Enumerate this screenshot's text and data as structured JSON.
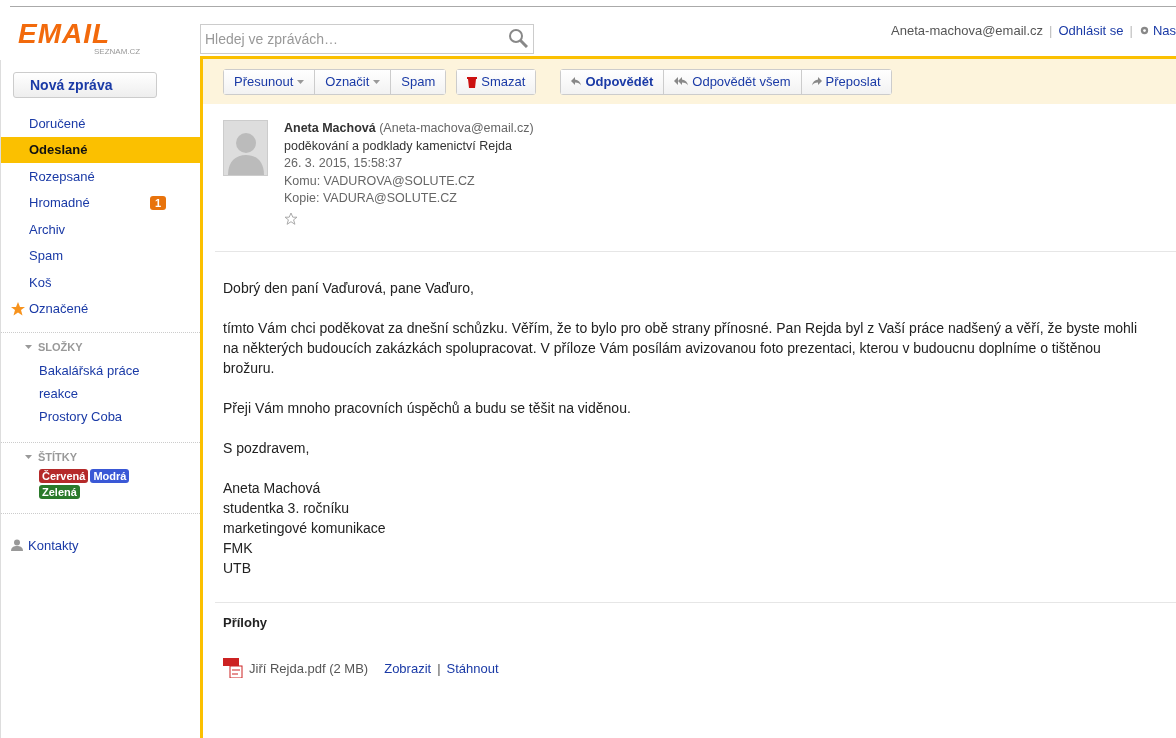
{
  "logo": {
    "title": "EMAIL",
    "subtitle": "SEZNAM.CZ"
  },
  "search": {
    "placeholder": "Hledej ve zprávách…"
  },
  "account": {
    "email": "Aneta-machova@email.cz",
    "separator_1": "|",
    "logout": "Odhlásit se",
    "separator_2": "|",
    "settings": "Nas"
  },
  "new_message": "Nová zpráva",
  "folders": [
    {
      "label": "Doručené",
      "selected": false
    },
    {
      "label": "Odeslané",
      "selected": true
    },
    {
      "label": "Rozepsané",
      "selected": false
    },
    {
      "label": "Hromadné",
      "selected": false,
      "badge": "1"
    },
    {
      "label": "Archiv",
      "selected": false
    },
    {
      "label": "Spam",
      "selected": false
    },
    {
      "label": "Koš",
      "selected": false
    },
    {
      "label": "Označené",
      "selected": false,
      "kind": "starred"
    }
  ],
  "custom_folders": {
    "title": "SLOŽKY",
    "items": [
      "Bakalářská práce",
      "reakce",
      "Prostory Coba"
    ]
  },
  "labels": {
    "title": "ŠTÍTKY",
    "items": [
      {
        "label": "Červená",
        "color": "#b52a2a"
      },
      {
        "label": "Modrá",
        "color": "#3a58d6"
      },
      {
        "label": "Zelená",
        "color": "#2b7a2b"
      }
    ]
  },
  "contacts": "Kontakty",
  "toolbar": [
    {
      "kind": "menu",
      "label": "Přesunout"
    },
    {
      "kind": "menu",
      "label": "Označit"
    },
    {
      "kind": "plain",
      "label": "Spam"
    },
    {
      "kind": "delete",
      "label": "Smazat"
    },
    {
      "kind": "reply",
      "label": "Odpovědět"
    },
    {
      "kind": "reply_all",
      "label": "Odpovědět všem"
    },
    {
      "kind": "forward",
      "label": "Přeposlat"
    }
  ],
  "message": {
    "sender": "Aneta Machová",
    "sender_email": "(Aneta-machova@email.cz)",
    "subject": "poděkování a podklady kamenictví Rejda",
    "date": "26. 3. 2015, 15:58:37",
    "to": "Komu: VADUROVA@SOLUTE.CZ",
    "cc": "Kopie: VADURA@SOLUTE.CZ",
    "starred": false,
    "body": [
      [
        "Dobrý den paní Vaďurová, pane Vaďuro,"
      ],
      [
        " tímto Vám chci poděkovat za dnešní schůzku. Věřím, že to bylo pro obě strany přínosné. Pan Rejda byl z Vaší práce nadšený a věří, že byste mohli na některých budoucích zakázkách spolupracovat. V příloze Vám posílám avizovanou foto prezentaci, kterou v budoucnu doplníme o tištěnou brožuru."
      ],
      [
        "Přeji Vám mnoho pracovních úspěchů a budu se těšit na viděnou."
      ],
      [
        "S pozdravem,"
      ],
      [
        "Aneta Machová",
        "studentka 3. ročníku",
        "marketingové komunikace",
        "FMK",
        "UTB"
      ]
    ]
  },
  "attachments": {
    "title": "Přílohy",
    "items": [
      {
        "name": "Jiří Rejda.pdf (2 MB)",
        "view": "Zobrazit",
        "separator": "|",
        "download": "Stáhnout"
      }
    ]
  }
}
